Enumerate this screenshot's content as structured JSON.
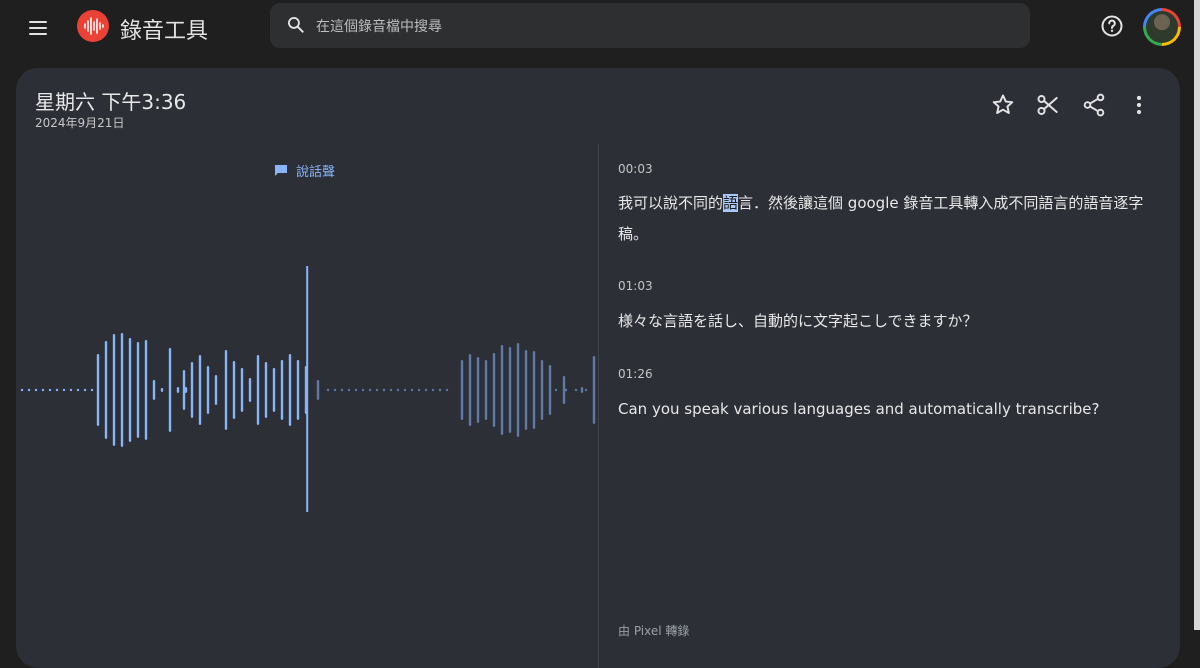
{
  "header": {
    "app_title": "錄音工具",
    "search_placeholder": "在這個錄音檔中搜尋",
    "icons": [
      "menu-icon",
      "recorder-logo-icon",
      "search-icon",
      "help-icon",
      "avatar"
    ]
  },
  "recording": {
    "title": "星期六 下午3:36",
    "date": "2024年9月21日",
    "actions": [
      "star-icon",
      "scissors-icon",
      "share-icon",
      "more-vert-icon"
    ]
  },
  "waveform": {
    "speaker_label": "說話聲",
    "progress": 0.49
  },
  "transcript": [
    {
      "time": "00:03",
      "pre": "我可以說不同的",
      "highlight": "語",
      "post": "言．然後讓這個 google 錄音工具轉入成不同語言的語音逐字稿。"
    },
    {
      "time": "01:03",
      "text": "様々な言語を話し、自動的に文字起こしできますか？"
    },
    {
      "time": "01:26",
      "text": "Can you speak various languages and automatically transcribe?"
    }
  ],
  "footer_note": "由 Pixel 轉錄",
  "colors": {
    "background": "#1f1f1f",
    "card": "#2c2f36",
    "accent_blue": "#8ab4f8",
    "played_wave": "#8ab4f8",
    "unplayed_wave": "#5f7aa6",
    "logo_red": "#ea4335"
  }
}
